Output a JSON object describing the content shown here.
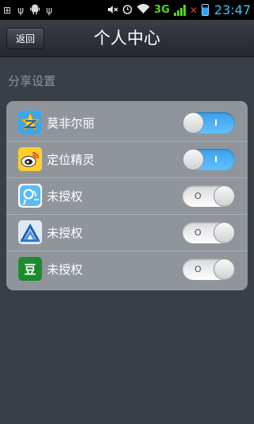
{
  "status_bar": {
    "network": "3G",
    "time": "23:47"
  },
  "header": {
    "back_label": "返回",
    "title": "个人中心"
  },
  "section": {
    "title": "分享设置"
  },
  "share_items": [
    {
      "label": "莫非尔丽",
      "icon": "qzone-icon",
      "toggle": "on",
      "toggle_mark": "I"
    },
    {
      "label": "定位精灵",
      "icon": "weibo-icon",
      "toggle": "on",
      "toggle_mark": "I"
    },
    {
      "label": "未授权",
      "icon": "tencent-weibo-icon",
      "toggle": "off",
      "toggle_mark": "O"
    },
    {
      "label": "未授权",
      "icon": "renren-icon",
      "toggle": "off",
      "toggle_mark": "O"
    },
    {
      "label": "未授权",
      "icon": "douban-icon",
      "toggle": "off",
      "toggle_mark": "O",
      "icon_glyph": "豆"
    }
  ],
  "colors": {
    "toggle_on": "#4fb2f7",
    "background": "#3a3f47",
    "card": "#90959c"
  }
}
